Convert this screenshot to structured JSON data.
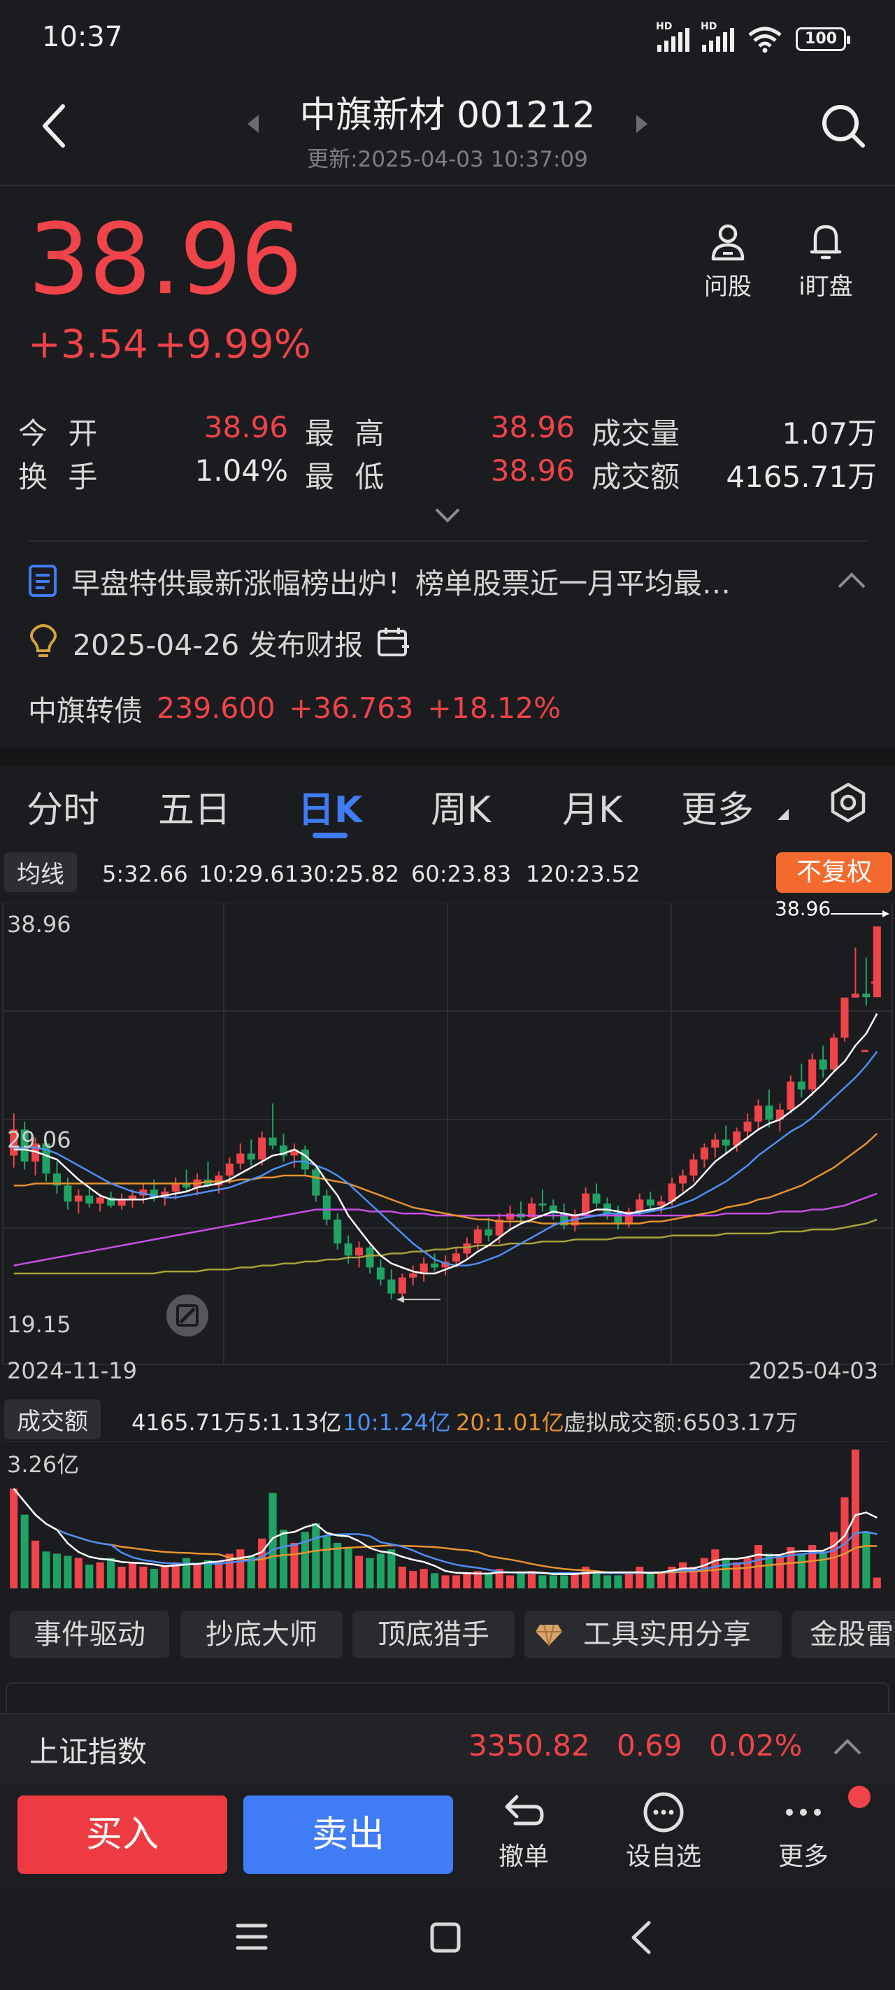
{
  "status_bar": {
    "time": "10:37",
    "hd1": "HD",
    "hd2": "HD",
    "battery": "100"
  },
  "header": {
    "title": "中旗新材 001212",
    "update_time": "更新:2025-04-03 10:37:09"
  },
  "quote": {
    "price": "38.96",
    "change": "+3.54",
    "change_pct": "+9.99%"
  },
  "top_tools": [
    {
      "label": "问股",
      "icon": "user-icon"
    },
    {
      "label": "i盯盘",
      "icon": "bell-icon"
    }
  ],
  "stats": {
    "open_label": "今 开",
    "open": "38.96",
    "high_label": "最 高",
    "high": "38.96",
    "volume_label": "成交量",
    "volume": "1.07万",
    "turnover_label": "换 手",
    "turnover": "1.04%",
    "low_label": "最 低",
    "low": "38.96",
    "amount_label": "成交额",
    "amount": "4165.71万"
  },
  "news": {
    "headline": "早盘特供最新涨幅榜出炉！榜单股票近一月平均最…"
  },
  "report": {
    "text": "2025-04-26 发布财报"
  },
  "bond": {
    "name": "中旗转债",
    "price": "239.600",
    "change": "+36.763",
    "pct": "+18.12%"
  },
  "tabs": [
    "分时",
    "五日",
    "日K",
    "周K",
    "月K",
    "更多"
  ],
  "active_tab": "日K",
  "ma_legend": {
    "label": "均线",
    "ma5": "5:32.66",
    "ma10": "10:29.61",
    "ma30": "30:25.82",
    "ma60": "60:23.83",
    "ma120": "120:23.52",
    "colors": {
      "ma5": "#ffffff",
      "ma10": "#4d8ff7",
      "ma30": "#e8932b",
      "ma60": "#c84ee6",
      "ma120": "#a7a23a"
    }
  },
  "fuquan": "不复权",
  "chart_data": [
    {
      "type": "candlestick",
      "yticks": [
        "38.96",
        "29.06",
        "19.15"
      ],
      "ylim": [
        19.15,
        38.96
      ],
      "x_start": "2024-11-19",
      "x_end": "2025-04-03",
      "last_close_label": "38.96",
      "candles": [
        [
          27.5,
          29.6,
          26.9,
          28.8
        ],
        [
          28.8,
          29.2,
          26.8,
          27.2
        ],
        [
          27.2,
          28.4,
          26.5,
          28.1
        ],
        [
          28.1,
          28.3,
          26.2,
          26.6
        ],
        [
          26.6,
          27.2,
          25.6,
          26.0
        ],
        [
          26.0,
          26.4,
          24.8,
          25.2
        ],
        [
          25.2,
          25.8,
          24.6,
          25.5
        ],
        [
          25.5,
          25.9,
          24.9,
          25.1
        ],
        [
          25.1,
          25.6,
          24.7,
          25.4
        ],
        [
          25.4,
          25.7,
          24.9,
          25.0
        ],
        [
          25.0,
          25.6,
          24.8,
          25.3
        ],
        [
          25.3,
          25.8,
          24.9,
          25.5
        ],
        [
          25.5,
          26.1,
          25.1,
          25.8
        ],
        [
          25.8,
          26.3,
          25.2,
          25.4
        ],
        [
          25.4,
          25.9,
          25.0,
          25.7
        ],
        [
          25.7,
          26.4,
          25.3,
          26.1
        ],
        [
          26.1,
          26.8,
          25.7,
          25.9
        ],
        [
          25.9,
          26.6,
          25.5,
          26.3
        ],
        [
          26.3,
          27.2,
          25.9,
          26.0
        ],
        [
          26.0,
          26.7,
          25.6,
          26.5
        ],
        [
          26.5,
          27.4,
          26.1,
          27.1
        ],
        [
          27.1,
          28.1,
          26.8,
          27.6
        ],
        [
          27.6,
          28.3,
          27.0,
          27.3
        ],
        [
          27.3,
          28.7,
          27.0,
          28.4
        ],
        [
          28.4,
          30.1,
          27.8,
          28.0
        ],
        [
          28.0,
          28.6,
          27.2,
          27.5
        ],
        [
          27.5,
          28.1,
          26.9,
          27.8
        ],
        [
          27.8,
          28.0,
          26.5,
          26.8
        ],
        [
          26.8,
          27.0,
          25.2,
          25.5
        ],
        [
          25.5,
          25.8,
          24.0,
          24.3
        ],
        [
          24.3,
          24.6,
          22.8,
          23.1
        ],
        [
          23.1,
          23.5,
          22.1,
          22.5
        ],
        [
          22.5,
          23.2,
          21.9,
          22.9
        ],
        [
          22.9,
          23.0,
          21.6,
          21.9
        ],
        [
          21.9,
          22.3,
          21.0,
          21.3
        ],
        [
          21.3,
          21.8,
          20.3,
          20.6
        ],
        [
          20.6,
          21.6,
          20.4,
          21.4
        ],
        [
          21.4,
          22.0,
          21.0,
          21.6
        ],
        [
          21.6,
          22.4,
          21.2,
          22.1
        ],
        [
          22.1,
          22.6,
          21.7,
          21.9
        ],
        [
          21.9,
          22.5,
          21.5,
          22.2
        ],
        [
          22.2,
          22.9,
          21.9,
          22.6
        ],
        [
          22.6,
          23.4,
          22.3,
          23.1
        ],
        [
          23.1,
          24.0,
          22.8,
          23.8
        ],
        [
          23.8,
          24.4,
          23.2,
          23.5
        ],
        [
          23.5,
          24.6,
          23.1,
          24.3
        ],
        [
          24.3,
          25.0,
          23.9,
          24.6
        ],
        [
          24.6,
          25.2,
          24.1,
          24.4
        ],
        [
          24.4,
          25.4,
          24.2,
          25.1
        ],
        [
          25.1,
          25.8,
          24.7,
          25.0
        ],
        [
          25.0,
          25.3,
          24.3,
          24.6
        ],
        [
          24.6,
          25.1,
          23.8,
          24.0
        ],
        [
          24.0,
          24.8,
          23.7,
          24.5
        ],
        [
          24.5,
          25.9,
          24.4,
          25.6
        ],
        [
          25.6,
          26.1,
          24.9,
          25.1
        ],
        [
          25.1,
          25.4,
          24.3,
          24.6
        ],
        [
          24.6,
          25.0,
          23.8,
          24.1
        ],
        [
          24.1,
          24.9,
          23.9,
          24.7
        ],
        [
          24.7,
          25.6,
          24.5,
          25.3
        ],
        [
          25.3,
          25.7,
          24.7,
          25.0
        ],
        [
          25.0,
          25.5,
          24.6,
          25.2
        ],
        [
          25.2,
          26.4,
          25.0,
          26.1
        ],
        [
          26.1,
          26.8,
          25.7,
          26.5
        ],
        [
          26.5,
          27.6,
          26.2,
          27.3
        ],
        [
          27.3,
          28.1,
          26.9,
          27.9
        ],
        [
          27.9,
          28.6,
          27.4,
          28.3
        ],
        [
          28.3,
          29.0,
          27.6,
          28.0
        ],
        [
          28.0,
          28.9,
          27.7,
          28.7
        ],
        [
          28.7,
          29.6,
          28.3,
          29.2
        ],
        [
          29.2,
          30.3,
          28.8,
          30.0
        ],
        [
          30.0,
          30.8,
          28.9,
          29.3
        ],
        [
          29.3,
          30.1,
          28.7,
          29.8
        ],
        [
          29.8,
          31.5,
          29.6,
          31.2
        ],
        [
          31.2,
          32.1,
          30.4,
          30.8
        ],
        [
          30.8,
          32.6,
          30.5,
          32.3
        ],
        [
          32.3,
          33.0,
          31.4,
          31.8
        ],
        [
          31.8,
          33.6,
          31.7,
          33.4
        ],
        [
          33.4,
          35.4,
          33.2,
          35.4
        ],
        [
          35.4,
          37.9,
          35.4,
          35.6
        ],
        [
          35.6,
          37.4,
          35.0,
          35.42
        ],
        [
          35.42,
          38.96,
          35.42,
          38.96
        ]
      ],
      "ma5": [
        27.8,
        27.8,
        27.7,
        27.5,
        27.3,
        26.8,
        26.3,
        25.9,
        25.5,
        25.3,
        25.3,
        25.3,
        25.3,
        25.4,
        25.5,
        25.6,
        25.7,
        25.9,
        26.0,
        26.1,
        26.3,
        26.6,
        26.9,
        27.2,
        27.5,
        27.6,
        27.8,
        27.5,
        27.0,
        26.2,
        25.5,
        24.5,
        23.8,
        23.1,
        22.5,
        22.1,
        21.9,
        21.7,
        21.6,
        21.6,
        21.8,
        22.0,
        22.3,
        22.7,
        23.0,
        23.4,
        23.8,
        24.1,
        24.3,
        24.5,
        24.7,
        24.6,
        24.5,
        24.6,
        24.8,
        24.8,
        24.7,
        24.6,
        24.7,
        24.8,
        24.9,
        25.2,
        25.6,
        26.0,
        26.6,
        27.2,
        27.6,
        28.0,
        28.4,
        28.8,
        29.1,
        29.3,
        29.7,
        30.1,
        30.6,
        31.1,
        31.7,
        32.2,
        33.0,
        33.6,
        34.6
      ],
      "ma10": [
        27.9,
        27.9,
        27.9,
        27.8,
        27.6,
        27.3,
        27.0,
        26.7,
        26.4,
        26.1,
        25.9,
        25.7,
        25.6,
        25.5,
        25.4,
        25.4,
        25.5,
        25.6,
        25.7,
        25.8,
        25.9,
        26.1,
        26.3,
        26.5,
        26.8,
        27.0,
        27.2,
        27.2,
        27.0,
        26.8,
        26.5,
        26.1,
        25.6,
        25.1,
        24.6,
        24.1,
        23.6,
        23.1,
        22.7,
        22.3,
        22.1,
        22.0,
        22.0,
        22.1,
        22.3,
        22.5,
        22.8,
        23.1,
        23.4,
        23.7,
        24.0,
        24.2,
        24.3,
        24.4,
        24.5,
        24.6,
        24.6,
        24.6,
        24.6,
        24.7,
        24.8,
        24.9,
        25.1,
        25.3,
        25.6,
        25.9,
        26.2,
        26.6,
        27.0,
        27.5,
        27.9,
        28.3,
        28.7,
        29.0,
        29.4,
        29.9,
        30.4,
        30.9,
        31.4,
        32.0,
        32.7
      ],
      "ma30": [
        26.0,
        26.0,
        26.1,
        26.1,
        26.1,
        26.1,
        26.1,
        26.1,
        26.1,
        26.1,
        26.1,
        26.1,
        26.1,
        26.1,
        26.1,
        26.1,
        26.1,
        26.1,
        26.2,
        26.2,
        26.2,
        26.3,
        26.3,
        26.4,
        26.4,
        26.5,
        26.5,
        26.5,
        26.4,
        26.3,
        26.2,
        26.1,
        25.9,
        25.7,
        25.5,
        25.3,
        25.1,
        24.9,
        24.8,
        24.7,
        24.6,
        24.5,
        24.4,
        24.3,
        24.3,
        24.2,
        24.2,
        24.2,
        24.2,
        24.1,
        24.1,
        24.1,
        24.1,
        24.1,
        24.1,
        24.1,
        24.1,
        24.1,
        24.1,
        24.2,
        24.2,
        24.3,
        24.4,
        24.5,
        24.6,
        24.7,
        24.9,
        25.0,
        25.1,
        25.3,
        25.4,
        25.6,
        25.8,
        26.0,
        26.3,
        26.6,
        26.9,
        27.3,
        27.7,
        28.1,
        28.6
      ],
      "ma60": [
        22.0,
        22.1,
        22.2,
        22.3,
        22.4,
        22.5,
        22.6,
        22.7,
        22.8,
        22.9,
        23.0,
        23.1,
        23.2,
        23.3,
        23.4,
        23.5,
        23.6,
        23.7,
        23.8,
        23.9,
        24.0,
        24.1,
        24.2,
        24.3,
        24.4,
        24.5,
        24.6,
        24.7,
        24.8,
        24.8,
        24.8,
        24.8,
        24.8,
        24.7,
        24.7,
        24.7,
        24.6,
        24.6,
        24.6,
        24.5,
        24.5,
        24.5,
        24.5,
        24.5,
        24.5,
        24.5,
        24.5,
        24.5,
        24.5,
        24.5,
        24.5,
        24.5,
        24.5,
        24.5,
        24.5,
        24.5,
        24.5,
        24.5,
        24.5,
        24.5,
        24.5,
        24.5,
        24.5,
        24.5,
        24.5,
        24.5,
        24.6,
        24.6,
        24.6,
        24.6,
        24.6,
        24.7,
        24.7,
        24.7,
        24.8,
        24.8,
        24.9,
        25.0,
        25.2,
        25.4,
        25.6
      ],
      "ma120": [
        21.6,
        21.6,
        21.6,
        21.6,
        21.6,
        21.6,
        21.6,
        21.6,
        21.6,
        21.6,
        21.6,
        21.6,
        21.6,
        21.6,
        21.7,
        21.7,
        21.7,
        21.7,
        21.8,
        21.8,
        21.8,
        21.9,
        21.9,
        22.0,
        22.0,
        22.1,
        22.1,
        22.2,
        22.2,
        22.3,
        22.3,
        22.4,
        22.4,
        22.5,
        22.5,
        22.6,
        22.6,
        22.7,
        22.7,
        22.8,
        22.8,
        22.9,
        22.9,
        23.0,
        23.0,
        23.0,
        23.1,
        23.1,
        23.1,
        23.2,
        23.2,
        23.2,
        23.3,
        23.3,
        23.3,
        23.3,
        23.4,
        23.4,
        23.4,
        23.4,
        23.4,
        23.5,
        23.5,
        23.5,
        23.5,
        23.5,
        23.6,
        23.6,
        23.6,
        23.6,
        23.6,
        23.7,
        23.7,
        23.7,
        23.8,
        23.8,
        23.8,
        23.9,
        24.0,
        24.1,
        24.3
      ]
    },
    {
      "type": "bar",
      "title": "成交额",
      "ymax_label": "3.26亿",
      "ylim": [
        0,
        3.26
      ],
      "values": [
        2.3,
        1.7,
        1.1,
        0.85,
        0.8,
        0.75,
        0.7,
        0.55,
        0.6,
        0.7,
        0.5,
        0.6,
        0.5,
        0.45,
        0.5,
        0.6,
        0.7,
        0.55,
        0.65,
        0.6,
        0.8,
        0.9,
        0.75,
        1.15,
        2.2,
        1.35,
        1.05,
        1.3,
        1.5,
        1.2,
        1.05,
        0.95,
        0.75,
        0.7,
        0.8,
        0.9,
        0.5,
        0.4,
        0.45,
        0.35,
        0.3,
        0.3,
        0.35,
        0.4,
        0.35,
        0.45,
        0.3,
        0.35,
        0.4,
        0.3,
        0.3,
        0.3,
        0.35,
        0.5,
        0.4,
        0.3,
        0.3,
        0.35,
        0.5,
        0.35,
        0.35,
        0.5,
        0.6,
        0.5,
        0.7,
        0.9,
        0.7,
        0.6,
        0.7,
        1.0,
        0.8,
        0.75,
        0.95,
        0.8,
        1.0,
        0.85,
        1.3,
        2.1,
        3.2,
        1.3,
        0.25
      ],
      "ma5_label": "5:1.13亿",
      "ma10_label": "10:1.24亿",
      "ma20_label": "20:1.01亿",
      "current_label": "4165.71万",
      "virtual_label": "虚拟成交额:6503.17万"
    }
  ],
  "strategy_chips": [
    "事件驱动",
    "抄底大师",
    "顶底猎手",
    "工具实用分享",
    "金股雷"
  ],
  "index": {
    "name": "上证指数",
    "value": "3350.82",
    "change": "0.69",
    "pct": "0.02%"
  },
  "bottom": {
    "buy": "买入",
    "sell": "卖出",
    "cancel": "撤单",
    "watch": "设自选",
    "more": "更多"
  },
  "colors": {
    "up": "#f0434a",
    "down": "#1fa364",
    "accent": "#3f7cf5",
    "badge": "#f46a2e"
  }
}
